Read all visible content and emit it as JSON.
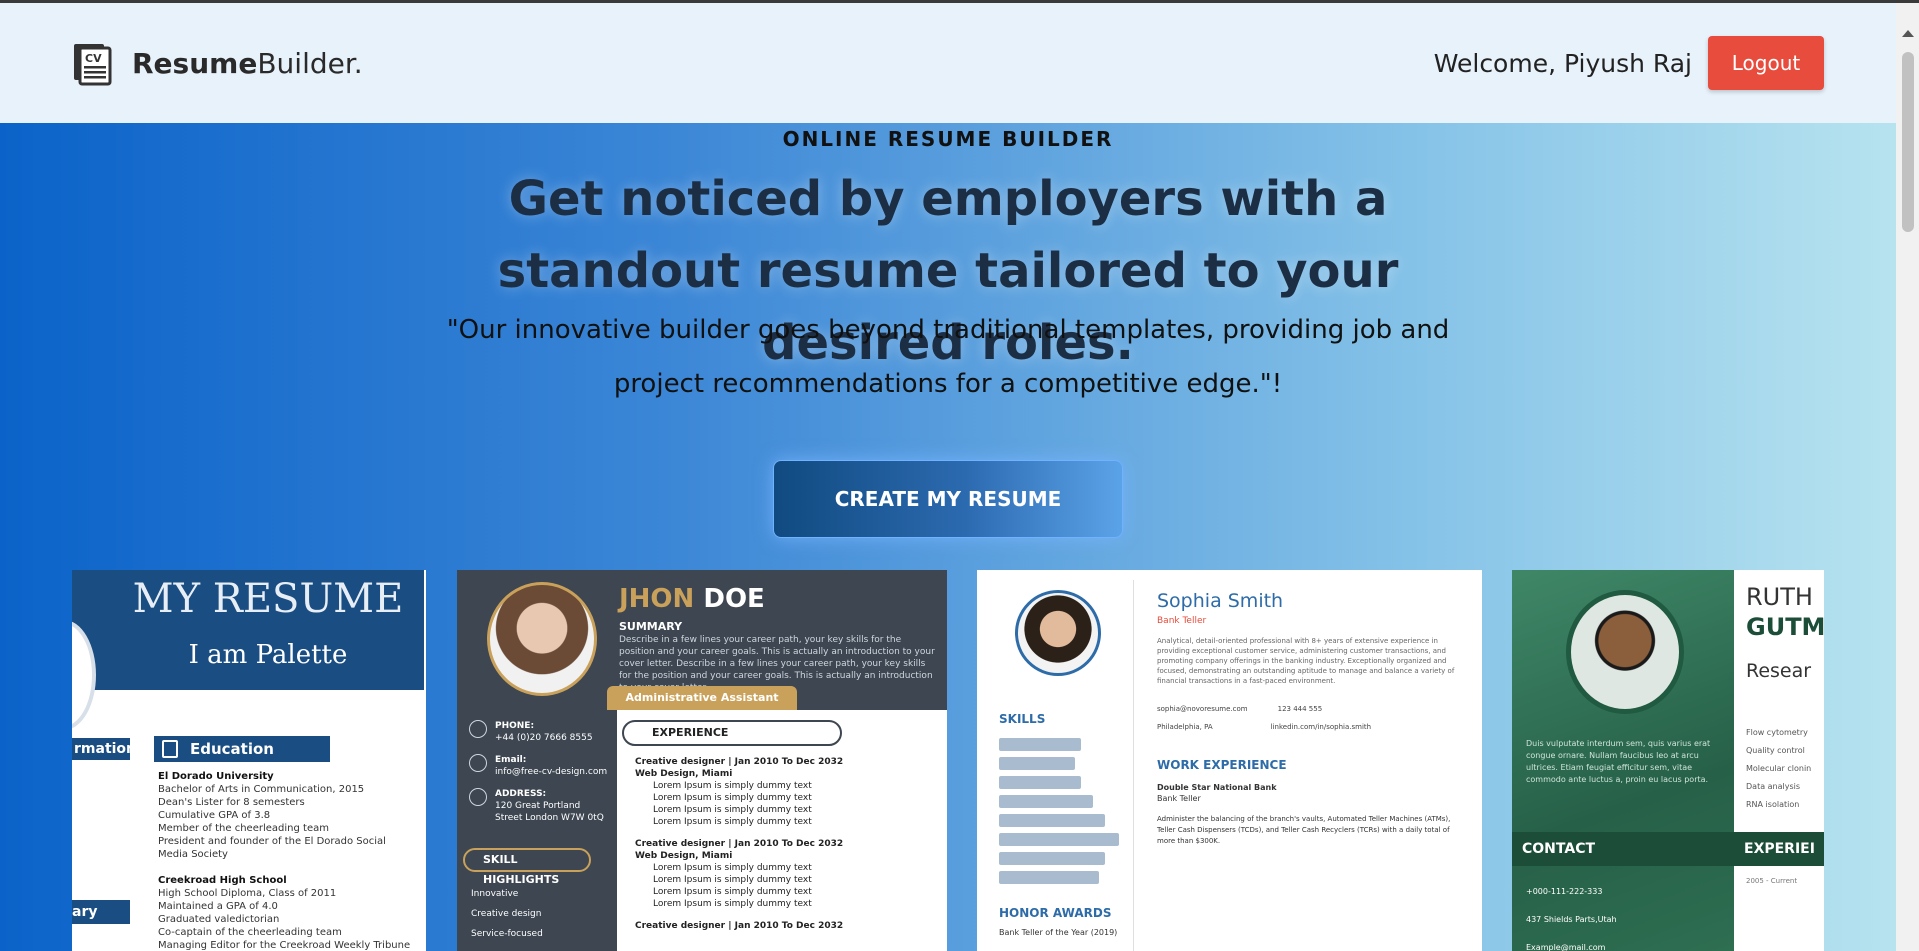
{
  "header": {
    "brand_bold": "Resume",
    "brand_light": "Builder.",
    "logo_text": "CV",
    "welcome": "Welcome, Piyush Raj",
    "logout_label": "Logout"
  },
  "hero": {
    "eyebrow": "ONLINE RESUME BUILDER",
    "headline": "Get noticed by employers with a standout resume tailored to your desired roles.",
    "subtext": "\"Our innovative builder goes beyond traditional templates, providing job and project recommendations for a competitive edge.\"!",
    "cta_label": "CREATE MY RESUME"
  },
  "templates": [
    {
      "title": "MY RESUME",
      "subtitle": "I am Palette",
      "tab_a": "rmation",
      "tab_b": "Education",
      "tab_c": "ary",
      "lines": [
        "El Dorado University",
        "Bachelor of Arts in Communication, 2015",
        "Dean's Lister for 8 semesters",
        "Cumulative GPA of 3.8",
        "Member of the cheerleading team",
        "President and founder of the El Dorado Social Media Society",
        "",
        "Creekroad High School",
        "High School Diploma, Class of 2011",
        "Maintained a GPA of 4.0",
        "Graduated valedictorian",
        "Co-captain of the cheerleading team",
        "Managing Editor for the Creekroad Weekly Tribune"
      ]
    },
    {
      "first": "JHON",
      "last": "DOE",
      "summary_label": "SUMMARY",
      "summary": "Describe in a few lines your career path, your key skills for the position and your career goals. This is actually an introduction to your cover letter. Describe in a few lines your career path, your key skills for the position and your career goals. This is actually an introduction to your cover letter.",
      "role": "Administrative Assistant",
      "phone_label": "PHONE:",
      "phone": "+44 (0)20 7666 8555",
      "email_label": "Email:",
      "email": "info@free-cv-design.com",
      "address_label": "ADDRESS:",
      "address": "120 Great Portland Street London W7W 0tQ",
      "skills_label": "SKILL HIGHLIGHTS",
      "skills": [
        "Innovative",
        "Creative design",
        "Service-focused"
      ],
      "experience_label": "EXPERIENCE",
      "job_title": "Creative designer | Jan 2010 To Dec 2032",
      "job_company": "Web Design, Miami",
      "bullet": "Lorem Ipsum is simply dummy text"
    },
    {
      "name": "Sophia Smith",
      "job": "Bank Teller",
      "bio": "Analytical, detail-oriented professional with 8+ years of extensive experience in providing exceptional customer service, administering customer transactions, and promoting company offerings in the banking industry. Exceptionally organized and focused, demonstrating an outstanding aptitude to manage and balance a variety of financial transactions in a fast-paced environment.",
      "skills_label": "SKILLS",
      "honor_label": "HONOR AWARDS",
      "honor": "Bank Teller of the Year (2019)",
      "contacts": [
        "sophia@novoresume.com",
        "Philadelphia, PA",
        "123 444 555",
        "linkedin.com/in/sophia.smith"
      ],
      "work_label": "WORK EXPERIENCE",
      "work_company": "Double Star National Bank",
      "work_role": "Bank Teller",
      "work_desc": "Administer the balancing of the branch's vaults, Automated Teller Machines (ATMs), Teller Cash Dispensers (TCDs), and Teller Cash Recyclers (TCRs) with a daily total of more than $300K."
    },
    {
      "name1": "RUTH",
      "name2": "GUTM",
      "subtitle": "Resear",
      "left_text": "Duis vulputate interdum sem, quis varius erat congue ornare. Nullam faucibus leo at arcu ultrices. Etiam feugiat efficitur sem, vitae commodo ante luctus a, proin eu lacus porta.",
      "contact_label": "CONTACT",
      "experience_label": "EXPERIEI",
      "contact_lines": [
        "+000-111-222-333",
        "437 Shields Parts,Utah",
        "Example@mail.com"
      ],
      "right_list": [
        "Flow cytometry",
        "Quality control",
        "Molecular clonin",
        "Data analysis",
        "RNA isolation"
      ],
      "right_small": "2005 - Current"
    }
  ]
}
